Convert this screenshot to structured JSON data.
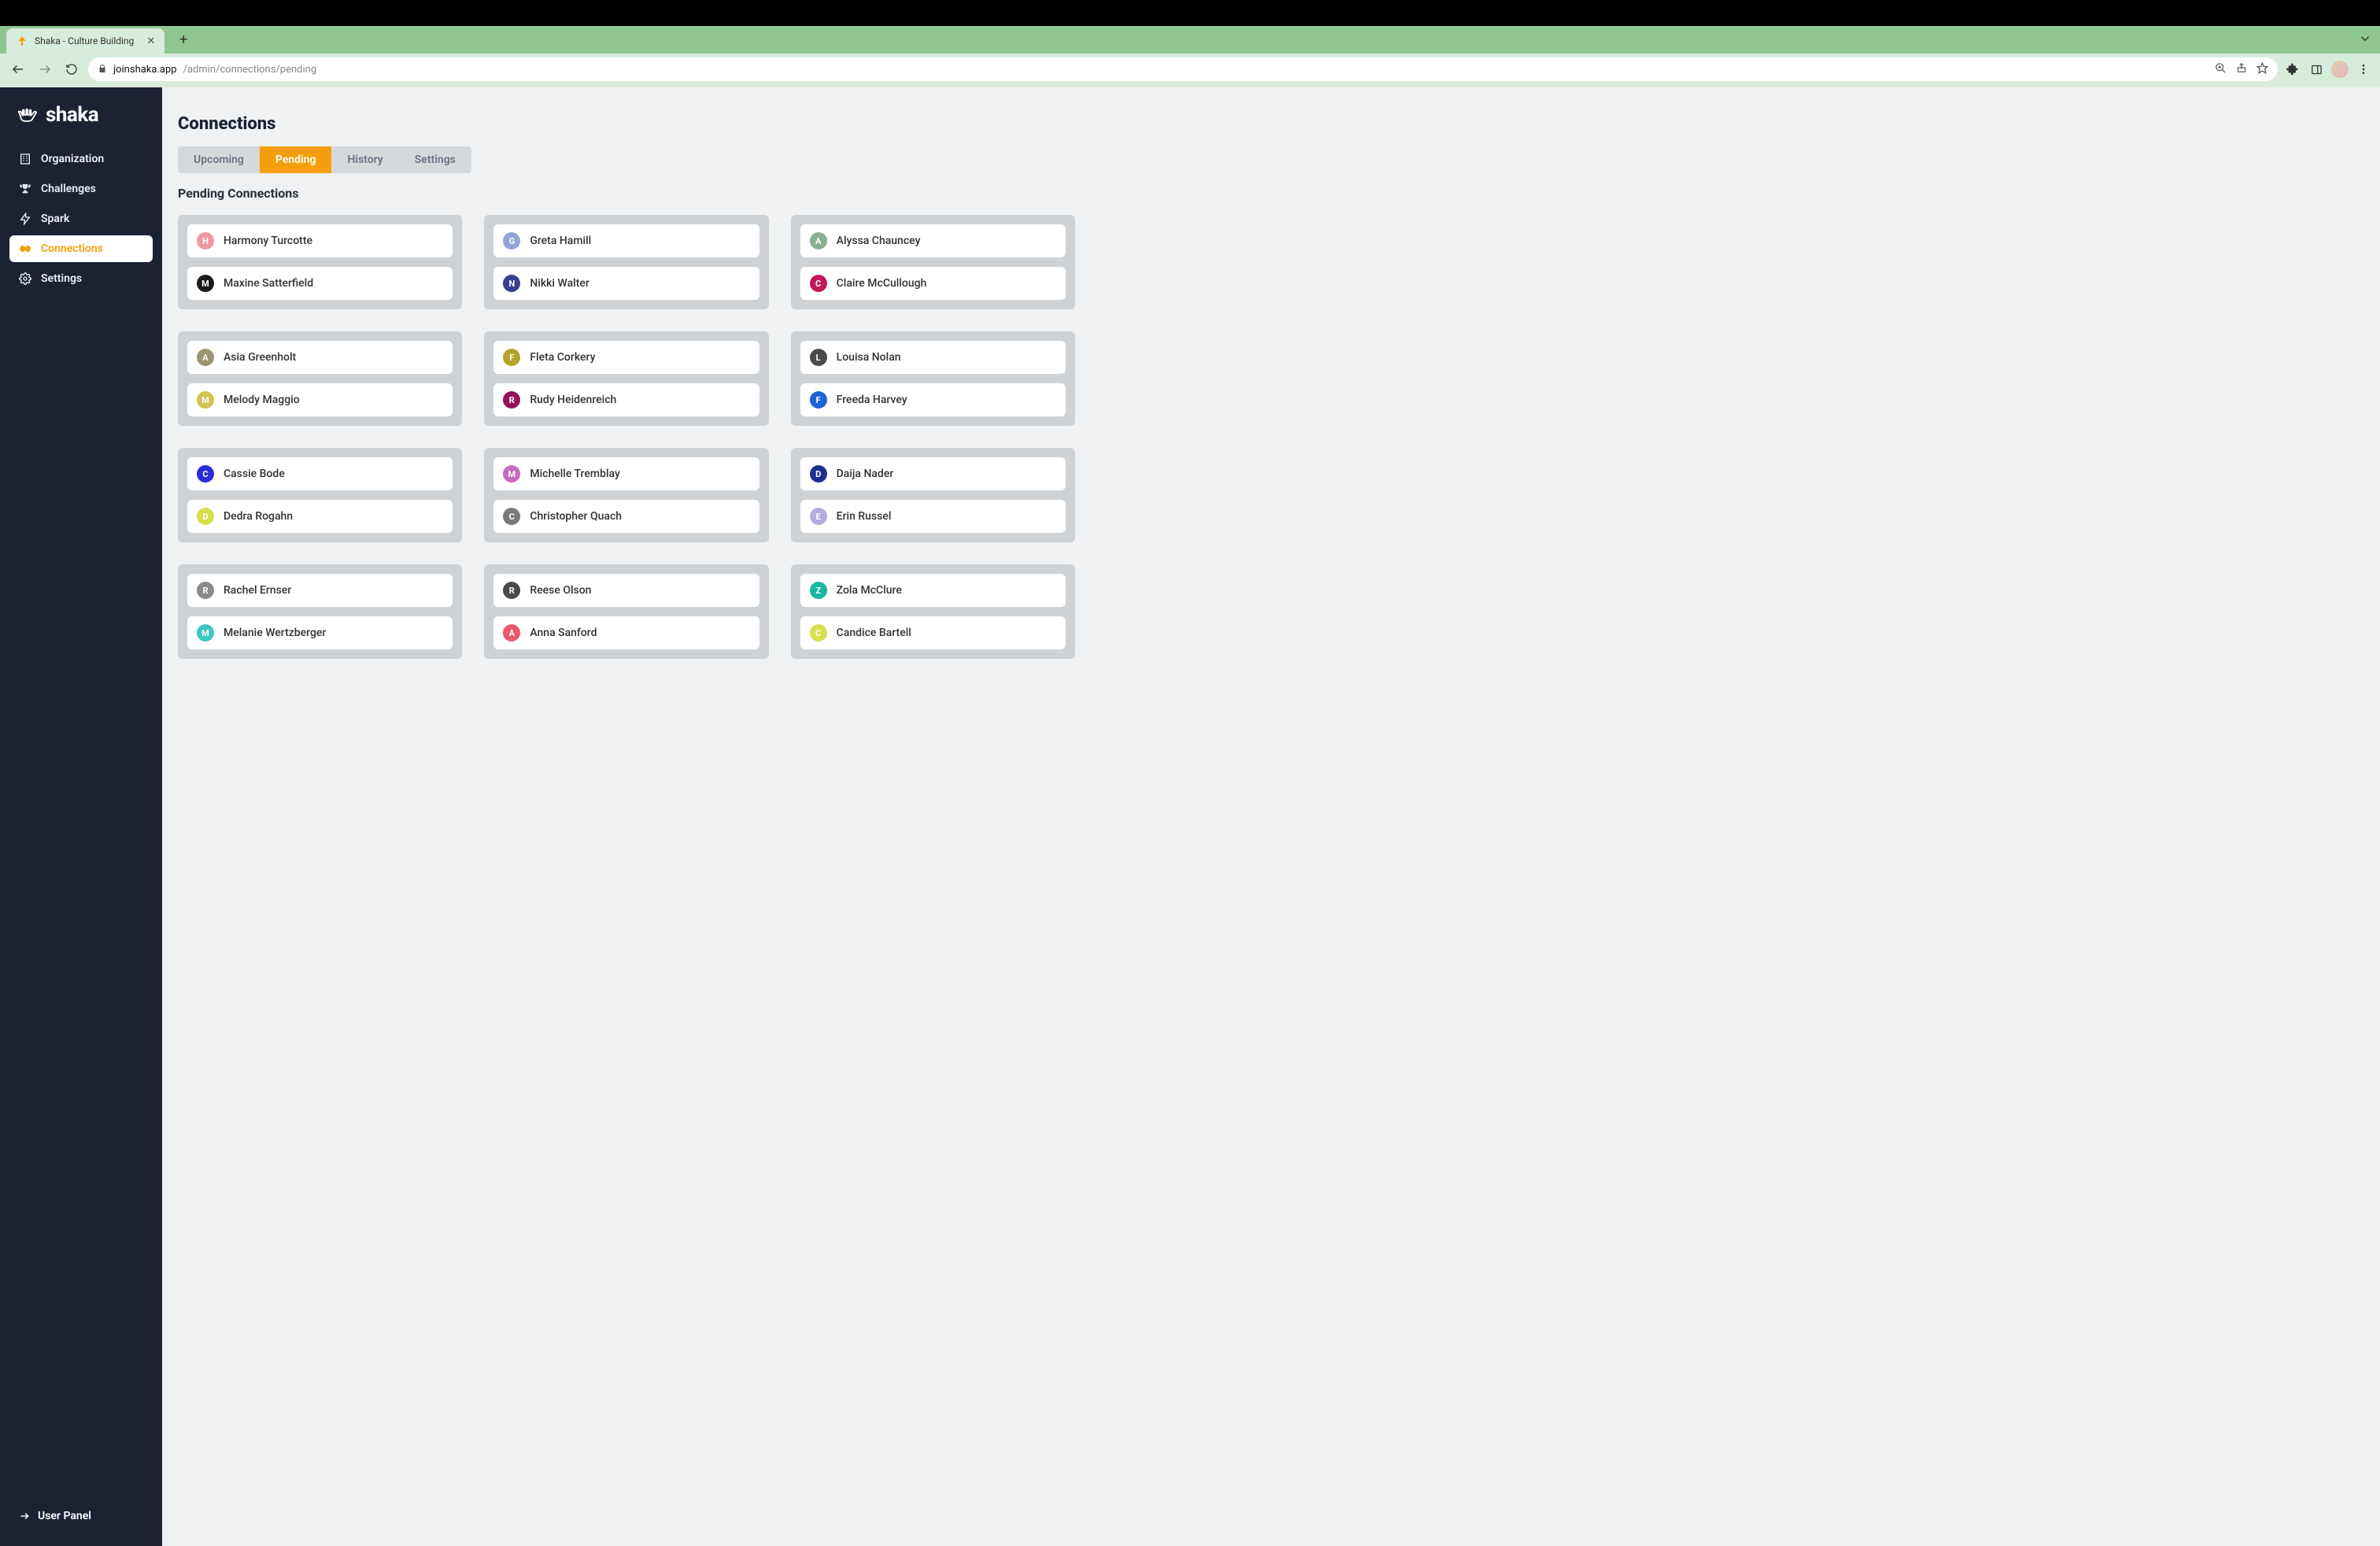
{
  "browser": {
    "tab_title": "Shaka - Culture Building",
    "url_domain": "joinshaka.app",
    "url_path": "/admin/connections/pending"
  },
  "sidebar": {
    "logo_text": "shaka",
    "items": [
      {
        "label": "Organization",
        "icon": "building-icon",
        "active": false
      },
      {
        "label": "Challenges",
        "icon": "trophy-icon",
        "active": false
      },
      {
        "label": "Spark",
        "icon": "bolt-icon",
        "active": false
      },
      {
        "label": "Connections",
        "icon": "handshake-icon",
        "active": true
      },
      {
        "label": "Settings",
        "icon": "gear-icon",
        "active": false
      }
    ],
    "bottom_link": "User Panel"
  },
  "page": {
    "title": "Connections",
    "tabs": [
      {
        "label": "Upcoming",
        "active": false
      },
      {
        "label": "Pending",
        "active": true
      },
      {
        "label": "History",
        "active": false
      },
      {
        "label": "Settings",
        "active": false
      }
    ],
    "section_title": "Pending Connections"
  },
  "connections": [
    {
      "pair": [
        {
          "name": "Harmony Turcotte",
          "initial": "H",
          "color": "#ef98a1"
        },
        {
          "name": "Maxine Satterfield",
          "initial": "M",
          "color": "#1a1a1a"
        }
      ]
    },
    {
      "pair": [
        {
          "name": "Greta Hamill",
          "initial": "G",
          "color": "#93a4d6"
        },
        {
          "name": "Nikki Walter",
          "initial": "N",
          "color": "#3b3e8e"
        }
      ]
    },
    {
      "pair": [
        {
          "name": "Alyssa Chauncey",
          "initial": "A",
          "color": "#8bb08f"
        },
        {
          "name": "Claire McCullough",
          "initial": "C",
          "color": "#c2185b"
        }
      ]
    },
    {
      "pair": [
        {
          "name": "Asia Greenholt",
          "initial": "A",
          "color": "#9a9470"
        },
        {
          "name": "Melody Maggio",
          "initial": "M",
          "color": "#d4c34f"
        }
      ]
    },
    {
      "pair": [
        {
          "name": "Fleta Corkery",
          "initial": "F",
          "color": "#b3a429"
        },
        {
          "name": "Rudy Heidenreich",
          "initial": "R",
          "color": "#8e1558"
        }
      ]
    },
    {
      "pair": [
        {
          "name": "Louisa Nolan",
          "initial": "L",
          "color": "#4a4a4a"
        },
        {
          "name": "Freeda Harvey",
          "initial": "F",
          "color": "#1e63d6"
        }
      ]
    },
    {
      "pair": [
        {
          "name": "Cassie Bode",
          "initial": "C",
          "color": "#2b2bd6"
        },
        {
          "name": "Dedra Rogahn",
          "initial": "D",
          "color": "#d6e04f"
        }
      ]
    },
    {
      "pair": [
        {
          "name": "Michelle Tremblay",
          "initial": "M",
          "color": "#c76bbd"
        },
        {
          "name": "Christopher Quach",
          "initial": "C",
          "color": "#7a7a7a"
        }
      ]
    },
    {
      "pair": [
        {
          "name": "Daija Nader",
          "initial": "D",
          "color": "#1f2f8f"
        },
        {
          "name": "Erin Russel",
          "initial": "E",
          "color": "#b4aee0"
        }
      ]
    },
    {
      "pair": [
        {
          "name": "Rachel Ernser",
          "initial": "R",
          "color": "#8a8a8a"
        },
        {
          "name": "Melanie Wertzberger",
          "initial": "M",
          "color": "#3ec7c0"
        }
      ]
    },
    {
      "pair": [
        {
          "name": "Reese Olson",
          "initial": "R",
          "color": "#4a4a4a"
        },
        {
          "name": "Anna Sanford",
          "initial": "A",
          "color": "#ea5a6b"
        }
      ]
    },
    {
      "pair": [
        {
          "name": "Zola McClure",
          "initial": "Z",
          "color": "#18b89c"
        },
        {
          "name": "Candice Bartell",
          "initial": "C",
          "color": "#d6e04f"
        }
      ]
    }
  ]
}
